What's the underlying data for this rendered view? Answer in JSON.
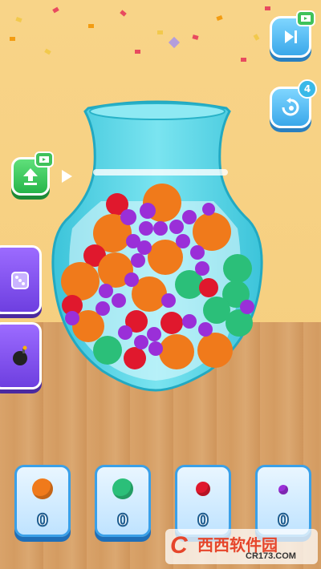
{
  "buttons": {
    "skip_level": {
      "icon": "skip-icon",
      "ad_icon": "video-ad-icon"
    },
    "undo": {
      "icon": "undo-icon",
      "count": "4"
    },
    "raise_water": {
      "icon": "arrow-up-icon",
      "ad_icon": "video-ad-icon"
    },
    "dice_powerup": {
      "icon": "dice-icon"
    },
    "bomb_powerup": {
      "icon": "bomb-icon"
    }
  },
  "collectors": [
    {
      "ball_color": "#f07a1b",
      "count": "0"
    },
    {
      "ball_color": "#2bbf79",
      "count": "0"
    },
    {
      "ball_color": "#e0182d",
      "count": "0"
    },
    {
      "ball_color": "#9a2fd8",
      "count": "0"
    }
  ],
  "watermark": {
    "text": "西西软件园",
    "url": "CR173.COM"
  },
  "colors": {
    "orange": "#f07a1b",
    "green": "#2bbf79",
    "red": "#e0182d",
    "purple": "#9a2fd8",
    "vase": "#4fd3e6"
  }
}
